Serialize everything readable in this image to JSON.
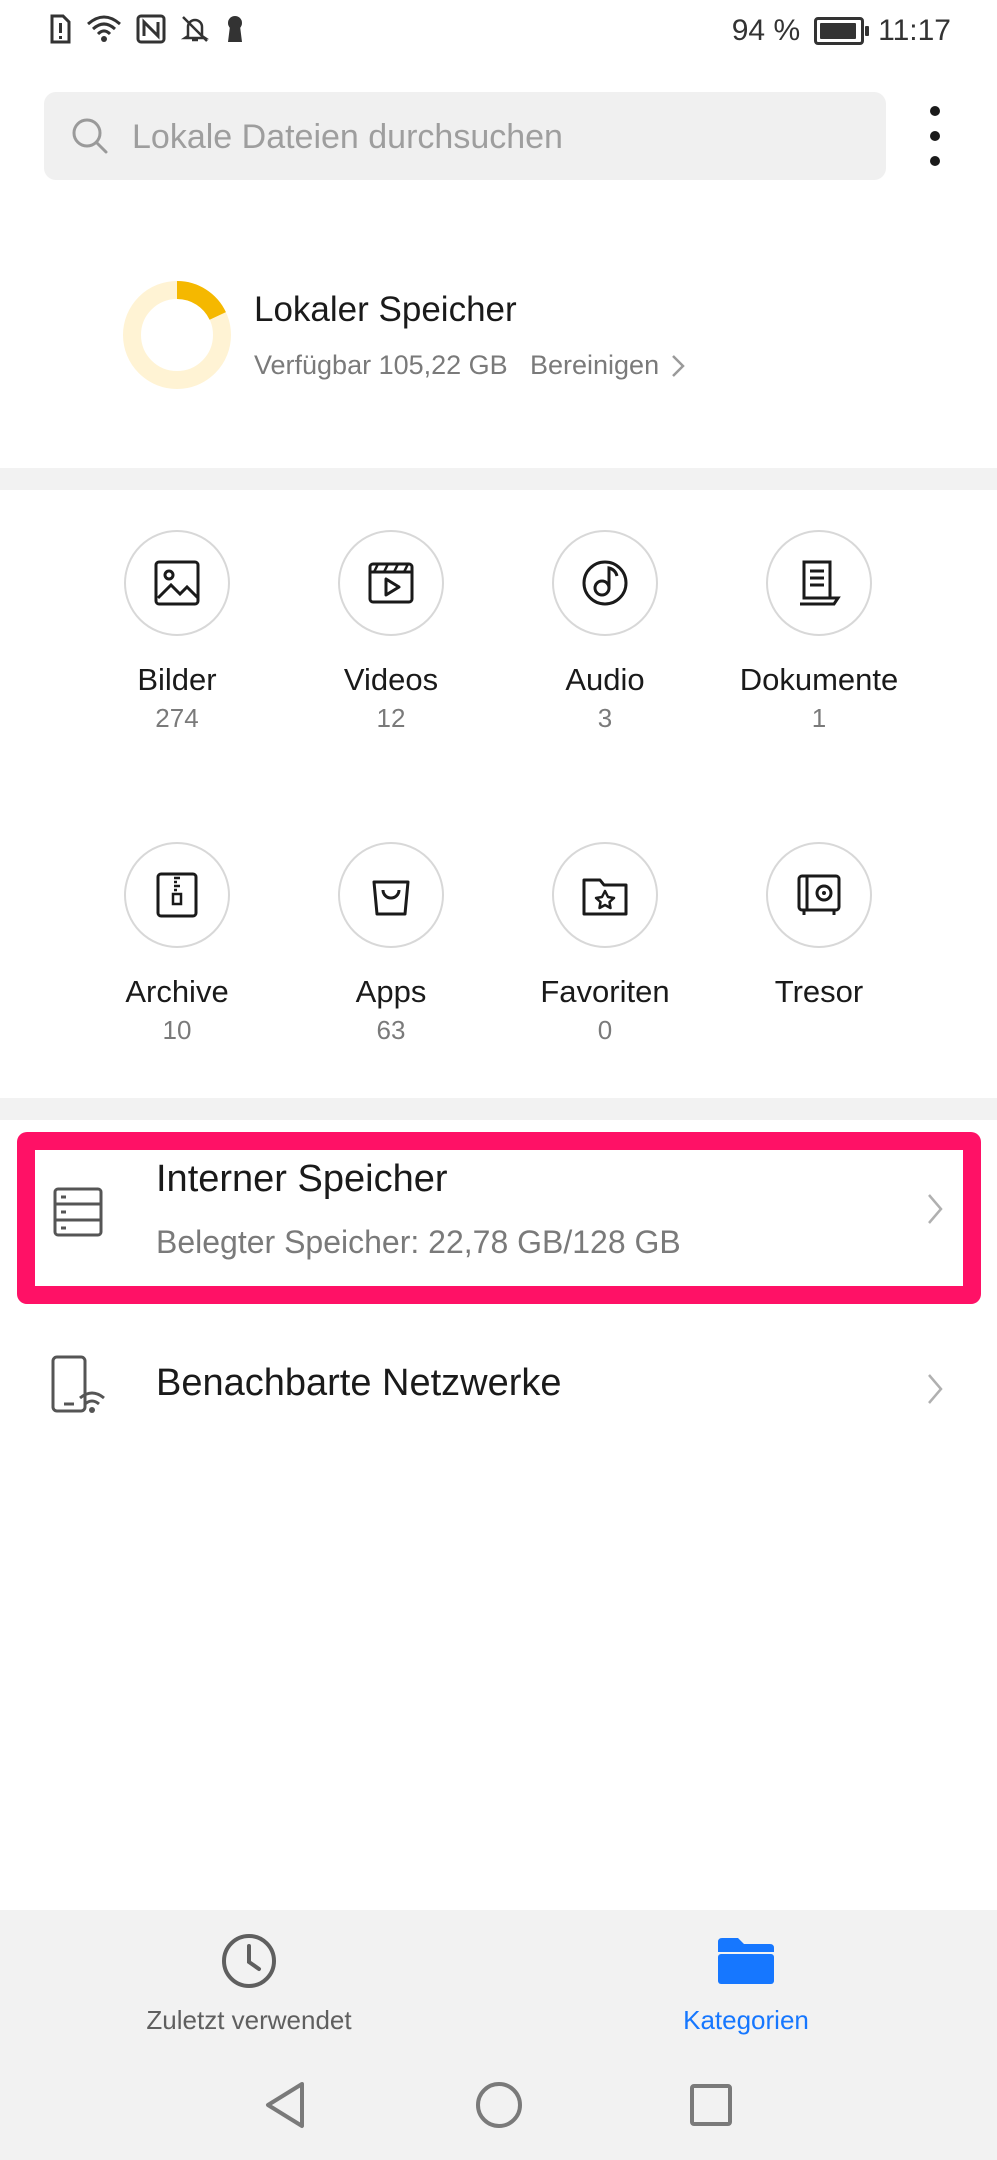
{
  "status_bar": {
    "battery": "94 %",
    "time": "11:17",
    "icons": [
      "sim-alert-icon",
      "wifi-icon",
      "nfc-icon",
      "mute-bell-icon",
      "keyhole-icon"
    ],
    "battery_level_fraction": 0.94
  },
  "search": {
    "placeholder": "Lokale Dateien durchsuchen"
  },
  "storage": {
    "title": "Lokaler Speicher",
    "available": "Verfügbar 105,22 GB",
    "cleanup": "Bereinigen",
    "used_fraction": 0.18,
    "ring_color": "#f5b800",
    "ring_bg_color": "#fff3d4"
  },
  "categories": [
    {
      "label": "Bilder",
      "count": "274",
      "icon": "image-icon"
    },
    {
      "label": "Videos",
      "count": "12",
      "icon": "video-icon"
    },
    {
      "label": "Audio",
      "count": "3",
      "icon": "audio-icon"
    },
    {
      "label": "Dokumente",
      "count": "1",
      "icon": "document-icon"
    },
    {
      "label": "Archive",
      "count": "10",
      "icon": "archive-icon"
    },
    {
      "label": "Apps",
      "count": "63",
      "icon": "apps-bag-icon"
    },
    {
      "label": "Favoriten",
      "count": "0",
      "icon": "favorites-star-icon"
    },
    {
      "label": "Tresor",
      "count": "",
      "icon": "safe-icon"
    }
  ],
  "rows": {
    "internal": {
      "title": "Interner Speicher",
      "subtitle": "Belegter Speicher: 22,78 GB/128 GB"
    },
    "network": {
      "title": "Benachbarte Netzwerke"
    }
  },
  "bottom_tabs": {
    "recent": "Zuletzt verwendet",
    "categories": "Kategorien"
  },
  "colors": {
    "accent": "#1677ff",
    "highlight": "#ff1166"
  }
}
